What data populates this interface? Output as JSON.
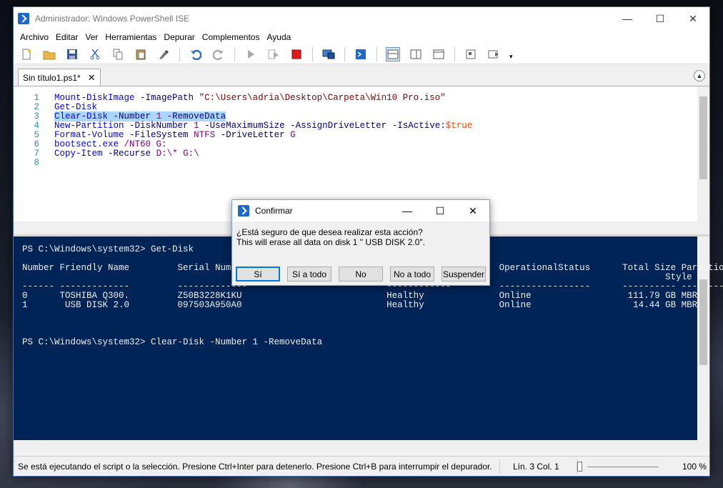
{
  "window": {
    "title": "Administrador: Windows PowerShell ISE",
    "minimize": "—",
    "maximize": "☐",
    "close": "✕"
  },
  "menu": [
    "Archivo",
    "Editar",
    "Ver",
    "Herramientas",
    "Depurar",
    "Complementos",
    "Ayuda"
  ],
  "toolbar_icons": [
    "new-file-icon",
    "open-folder-icon",
    "save-icon",
    "cut-icon",
    "copy-icon",
    "paste-icon",
    "clear-icon",
    "undo-icon",
    "redo-icon",
    "run-icon",
    "run-selection-icon",
    "stop-icon",
    "remote-powershell-icon",
    "console-icon",
    "layout-top-icon",
    "layout-right-icon",
    "layout-max-icon",
    "show-commands-icon",
    "show-addon-icon"
  ],
  "tab": {
    "label": "Sin título1.ps1*",
    "close": "✕"
  },
  "editor": {
    "lines": [
      {
        "n": "1",
        "text": "Mount-DiskImage -ImagePath \"C:\\Users\\adria\\Desktop\\Carpeta\\Win10 Pro.iso\""
      },
      {
        "n": "2",
        "text": "Get-Disk"
      },
      {
        "n": "3",
        "text": "Clear-Disk -Number 1 -RemoveData"
      },
      {
        "n": "4",
        "text": "New-Partition -DiskNumber 1 -UseMaximumSize -AssignDriveLetter -IsActive:$true"
      },
      {
        "n": "5",
        "text": "Format-Volume -FileSystem NTFS -DriveLetter G"
      },
      {
        "n": "6",
        "text": "bootsect.exe /NT60 G:"
      },
      {
        "n": "7",
        "text": "Copy-Item -Recurse D:\\* G:\\"
      },
      {
        "n": "8",
        "text": ""
      }
    ]
  },
  "console": {
    "lines": [
      "PS C:\\Windows\\system32> Get-Disk",
      "Number Friendly Name         Serial Number                          HealthStatus         OperationalStatus      Total Size Partition",
      "                                                                                                                        Style",
      "------ -------------         -------------                          ------------         -----------------      ---------- ---------",
      "0      TOSHIBA Q300.         Z50B3228K1KU                           Healthy              Online                  111.79 GB MBR",
      "1       USB DISK 2.0         097503A950A0                           Healthy              Online                   14.44 GB MBR",
      "PS C:\\Windows\\system32> Clear-Disk -Number 1 -RemoveData"
    ]
  },
  "status": {
    "message": "Se está ejecutando el script o la selección. Presione Ctrl+Inter para detenerlo. Presione Ctrl+B para interrumpir el depurador.",
    "position": "Lín. 3  Col. 1",
    "zoom": "100 %"
  },
  "dialog": {
    "title": "Confirmar",
    "question": "¿Está seguro de que desea realizar esta acción?",
    "detail": "This will erase all data on disk 1 \" USB DISK 2.0\".",
    "buttons": [
      "Sí",
      "Sí a todo",
      "No",
      "No a todo",
      "Suspender"
    ]
  }
}
